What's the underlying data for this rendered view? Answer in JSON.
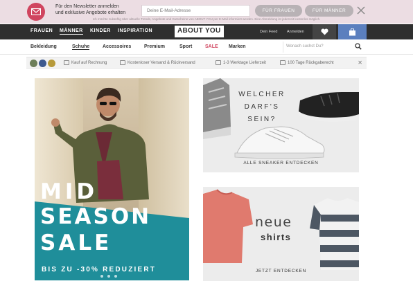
{
  "newsletter": {
    "line1": "Für den Newsletter anmelden",
    "line2": "und exklusive Angebote erhalten",
    "placeholder": "Deine E-Mail-Adresse",
    "btn_women": "FÜR FRAUEN",
    "btn_men": "FÜR MÄNNER",
    "fine_print": "Ich möchte zukünftig über aktuelle Trends, Angebote und Gutscheine von ABOUT YOU per E-Mail informiert werden. Eine Abmeldung ist jederzeit kostenlos möglich."
  },
  "topnav": {
    "items": [
      "FRAUEN",
      "MÄNNER",
      "KINDER",
      "INSPIRATION"
    ],
    "logo": "ABOUT YOU",
    "links": [
      "Dein Feed",
      "Anmelden"
    ]
  },
  "catnav": {
    "items": [
      "Bekleidung",
      "Schuhe",
      "Accessoires",
      "Premium",
      "Sport",
      "SALE",
      "Marken"
    ],
    "search_placeholder": "Wonach suchst Du?"
  },
  "benefits": {
    "items": [
      "Kauf auf Rechnung",
      "Kostenloser Versand & Rückversand",
      "1-3 Werktage Lieferzeit",
      "100 Tage Rückgaberecht"
    ]
  },
  "hero": {
    "line1": "MID",
    "line2": "SEASON",
    "line3": "SALE",
    "sub": "BIS ZU -30% REDUZIERT"
  },
  "sneakers": {
    "title": "WELCHER DARF'S SEIN?",
    "cta": "ALLE SNEAKER ENTDECKEN"
  },
  "shirts": {
    "line1": "neue",
    "line2": "shirts",
    "cta": "JETZT ENTDECKEN"
  },
  "colors": {
    "accent": "#d0455f",
    "nav_dark": "#2f2f2f",
    "cart_blue": "#5b7fbe",
    "teal": "#1f8e9a"
  }
}
